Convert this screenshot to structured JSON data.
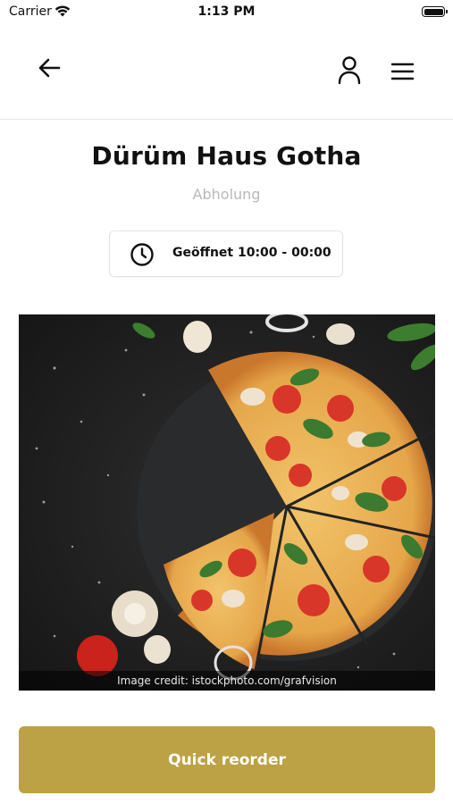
{
  "status_bar": {
    "carrier": "Carrier",
    "time": "1:13 PM"
  },
  "nav": {
    "back_icon": "arrow-left-icon",
    "account_icon": "user-icon",
    "menu_icon": "hamburger-menu-icon"
  },
  "restaurant": {
    "name": "Dürüm Haus Gotha",
    "order_type": "Abholung",
    "hours_icon": "clock-icon",
    "hours": "Geöffnet 10:00 - 00:00"
  },
  "hero_image": {
    "subject": "pizza",
    "credit": "Image credit: istockphoto.com/grafvision"
  },
  "actions": {
    "quick_reorder_label": "Quick reorder"
  },
  "colors": {
    "accent": "#bca244",
    "muted_text": "#b8b8b8",
    "divider": "#e6e6e6"
  }
}
